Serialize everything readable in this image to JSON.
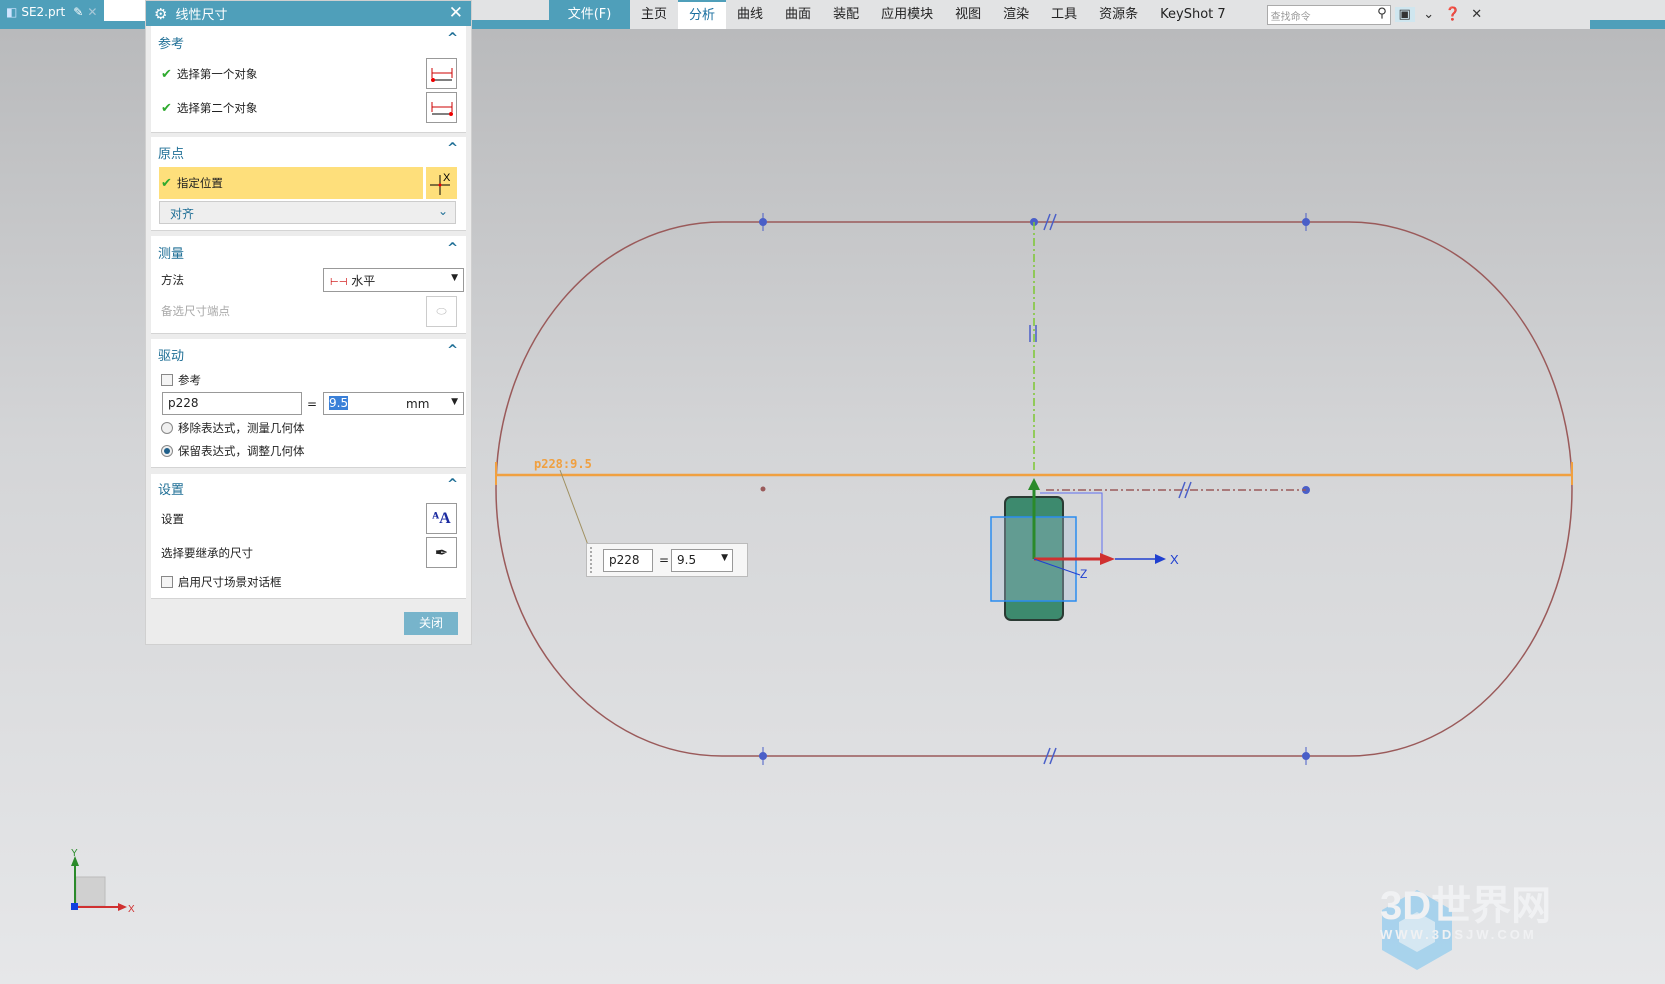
{
  "file_tab": {
    "name": "SE2.prt"
  },
  "menubar": {
    "items": [
      "文件(F)",
      "主页",
      "分析",
      "曲线",
      "曲面",
      "装配",
      "应用模块",
      "视图",
      "渲染",
      "工具",
      "资源条",
      "KeyShot 7"
    ],
    "active": "分析",
    "search_placeholder": "查找命令"
  },
  "dialog": {
    "title": "线性尺寸",
    "reference": {
      "header": "参考",
      "first": "选择第一个对象",
      "second": "选择第二个对象"
    },
    "origin": {
      "header": "原点",
      "specify": "指定位置",
      "align": "对齐"
    },
    "measure": {
      "header": "测量",
      "method_label": "方法",
      "method_value": "水平",
      "alt_endpoint": "备选尺寸端点"
    },
    "driving": {
      "header": "驱动",
      "reference_label": "参考",
      "reference_checked": false,
      "expr_name": "p228",
      "equals": "=",
      "value": "9.5",
      "unit": "mm",
      "option_remove": "移除表达式，测量几何体",
      "option_keep": "保留表达式，调整几何体",
      "selected_option": "keep"
    },
    "settings": {
      "header": "设置",
      "settings_label": "设置",
      "inherit_label": "选择要继承的尺寸",
      "scene_dialog_label": "启用尺寸场景对话框",
      "scene_dialog_checked": false
    },
    "close": "关闭"
  },
  "viewport": {
    "dimension_label": "p228:9.5",
    "popup": {
      "name": "p228",
      "equals": "=",
      "value": "9.5"
    },
    "csys_labels": {
      "x": "X",
      "y": "Y",
      "z": "Z"
    },
    "colors": {
      "sketch": "#9a5a5a",
      "dimension": "#f0a040",
      "constraint": "#4a5fc8",
      "body": "#3d8a6e"
    }
  },
  "watermark": {
    "title": "3D世界网",
    "url": "WWW.3DSJW.COM"
  }
}
